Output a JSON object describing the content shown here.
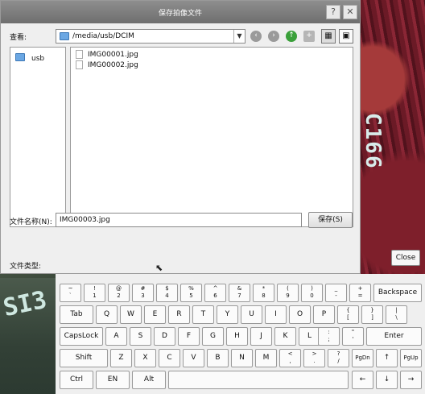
{
  "dialog": {
    "title": "保存拍像文件",
    "help_label": "?",
    "close_label": "✕",
    "look_in_label": "查看:",
    "path": "/media/usb/DCIM",
    "sidebar": [
      {
        "label": "usb",
        "icon": "folder-icon"
      }
    ],
    "files": [
      {
        "name": "IMG00001.jpg",
        "icon": "file-icon"
      },
      {
        "name": "IMG00002.jpg",
        "icon": "file-icon"
      }
    ],
    "filename_label": "文件名称(N):",
    "filename_value": "IMG00003.jpg",
    "save_label": "保存(S)",
    "filetype_label": "文件类型:"
  },
  "keyboard": {
    "close_label": "Close",
    "row1": [
      {
        "top": "~",
        "bot": "`"
      },
      {
        "top": "!",
        "bot": "1"
      },
      {
        "top": "@",
        "bot": "2"
      },
      {
        "top": "#",
        "bot": "3"
      },
      {
        "top": "$",
        "bot": "4"
      },
      {
        "top": "%",
        "bot": "5"
      },
      {
        "top": "^",
        "bot": "6"
      },
      {
        "top": "&",
        "bot": "7"
      },
      {
        "top": "*",
        "bot": "8"
      },
      {
        "top": "(",
        "bot": "9"
      },
      {
        "top": ")",
        "bot": "0"
      },
      {
        "top": "_",
        "bot": "-"
      },
      {
        "top": "+",
        "bot": "="
      }
    ],
    "backspace": "Backspace",
    "tab": "Tab",
    "row2": [
      "Q",
      "W",
      "E",
      "R",
      "T",
      "Y",
      "U",
      "I",
      "O",
      "P"
    ],
    "row2_sym": [
      {
        "top": "{",
        "bot": "["
      },
      {
        "top": "}",
        "bot": "]"
      },
      {
        "top": "|",
        "bot": "\\"
      }
    ],
    "capslock": "CapsLock",
    "row3": [
      "A",
      "S",
      "D",
      "F",
      "G",
      "H",
      "J",
      "K",
      "L"
    ],
    "row3_sym": [
      {
        "top": ":",
        "bot": ";"
      },
      {
        "top": "\"",
        "bot": "'"
      }
    ],
    "enter": "Enter",
    "shift": "Shift",
    "row4": [
      "Z",
      "X",
      "C",
      "V",
      "B",
      "N",
      "M"
    ],
    "row4_sym": [
      {
        "top": "<",
        "bot": ","
      },
      {
        "top": ">",
        "bot": "."
      },
      {
        "top": "?",
        "bot": "/"
      }
    ],
    "pgdn": "PgDn",
    "up": "↑",
    "pgup": "PgUp",
    "ctrl": "Ctrl",
    "en": "EN",
    "alt": "Alt",
    "left": "←",
    "down": "↓",
    "right": "→"
  },
  "background": {
    "pcb_label": "C166",
    "corner_label": "SI3"
  }
}
